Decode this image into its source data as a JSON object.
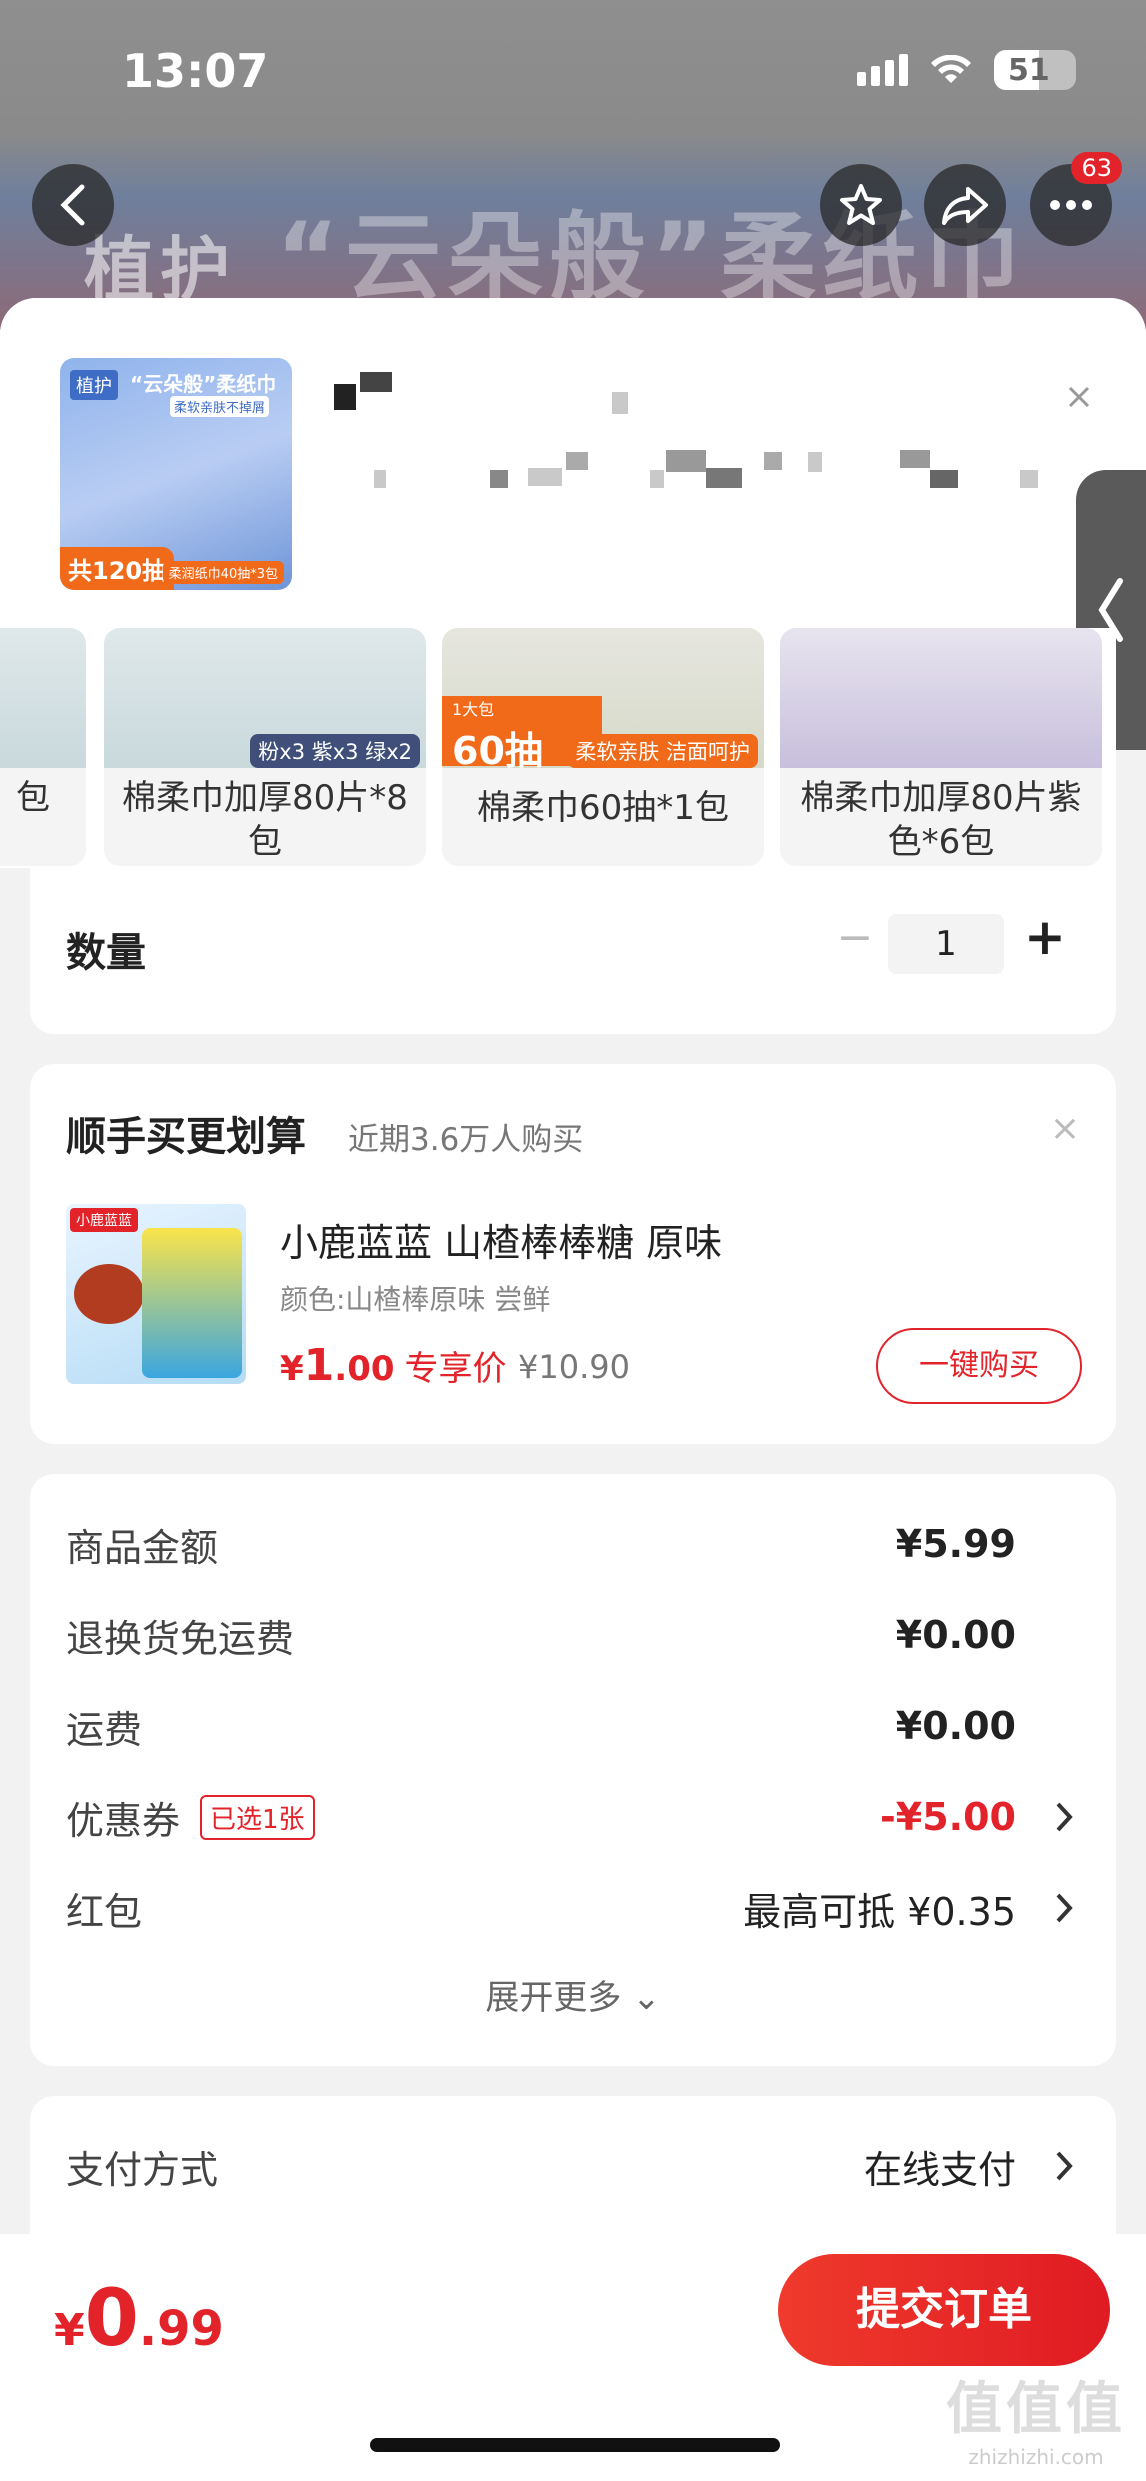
{
  "status_bar": {
    "time": "13:07",
    "battery": "51"
  },
  "banner": {
    "brand": "植护",
    "headline": "“云朵般”柔纸巾"
  },
  "nav": {
    "cart_badge": "63"
  },
  "sku_thumb": {
    "brand": "植护",
    "title": "“云朵般”柔纸巾",
    "sub": "柔软亲肤不掉屑",
    "count": "共120抽",
    "tag": "柔润纸巾40抽*3包"
  },
  "variants": [
    {
      "label": "包",
      "chip": "",
      "badge": ""
    },
    {
      "label": "棉柔巾加厚80片*8包",
      "chip": "粉x3 紫x3 绿x2",
      "badge": ""
    },
    {
      "label": "棉柔巾60抽*1包",
      "chip": "柔软亲肤 洁面呵护",
      "badge": "60抽",
      "badge_small": "1大包"
    },
    {
      "label": "棉柔巾加厚80片紫色*6包",
      "chip": "",
      "badge": ""
    }
  ],
  "quantity": {
    "label": "数量",
    "minus": "−",
    "value": "1",
    "plus": "+"
  },
  "upsell": {
    "title": "顺手买更划算",
    "subtitle": "近期3.6万人购买",
    "close": "×",
    "product_name": "小鹿蓝蓝 山楂棒棒糖 原味",
    "spec": "颜色:山楂棒原味  尝鲜",
    "price_symbol": "¥",
    "price_int": "1",
    "price_dec": ".00",
    "price_tag": "专享价",
    "original_price": "¥10.90",
    "button": "一键购买",
    "brand_logo": "小鹿蓝蓝"
  },
  "breakdown": {
    "rows": [
      {
        "label": "商品金额",
        "value": "¥5.99"
      },
      {
        "label": "退换货免运费",
        "value": "¥0.00"
      },
      {
        "label": "运费",
        "value": "¥0.00"
      },
      {
        "label": "优惠券",
        "chip": "已选1张",
        "value": "-¥5.00"
      },
      {
        "label": "红包",
        "value": "最高可抵 ¥0.35"
      }
    ],
    "expand": "展开更多 ⌄"
  },
  "payment": {
    "label": "支付方式",
    "value": "在线支付"
  },
  "bottom": {
    "symbol": "¥",
    "int": "0",
    "dec": ".99",
    "submit": "提交订单"
  },
  "watermark": {
    "line1": "值值值",
    "line2": "zhizhizhi.com"
  },
  "colors": {
    "accent": "#e2232a",
    "background": "#f2f2f2"
  }
}
